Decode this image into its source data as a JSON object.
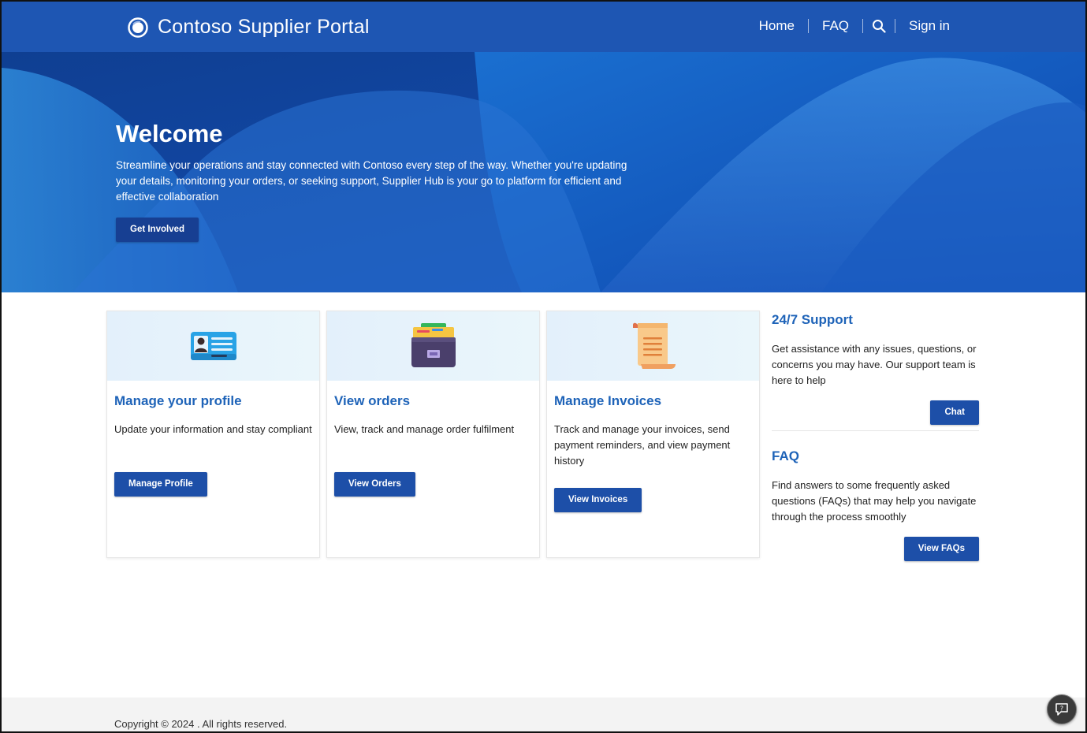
{
  "header": {
    "title": "Contoso Supplier Portal",
    "nav": {
      "home": "Home",
      "faq": "FAQ",
      "signin": "Sign in"
    },
    "logo_icon": "contoso-logo-icon",
    "search_icon": "search-icon",
    "color": "#1e56b3"
  },
  "hero": {
    "title": "Welcome",
    "text": "Streamline your operations and stay connected with Contoso every step of the way. Whether you're updating your details, monitoring your orders, or seeking support, Supplier Hub is your go to platform for efficient and effective collaboration",
    "button": "Get Involved"
  },
  "cards": [
    {
      "icon": "id-card-icon",
      "title": "Manage your profile",
      "text": "Update your information and stay compliant",
      "button": "Manage Profile"
    },
    {
      "icon": "file-box-icon",
      "title": "View orders",
      "text": "View, track and manage order fulfilment",
      "button": "View Orders"
    },
    {
      "icon": "scroll-icon",
      "title": "Manage Invoices",
      "text": "Track and manage your invoices, send payment reminders, and view payment history",
      "button": "View Invoices"
    }
  ],
  "support": {
    "title": "24/7 Support",
    "text": "Get assistance with any issues, questions, or concerns you may have. Our support team is here to help",
    "button": "Chat"
  },
  "faq": {
    "title": "FAQ",
    "text": "Find answers to some frequently asked questions (FAQs) that may help you navigate through the process smoothly",
    "button": "View FAQs"
  },
  "footer": {
    "copyright": "Copyright © 2024 . All rights reserved."
  },
  "chat_widget": {
    "icon": "chat-help-icon"
  },
  "colors": {
    "primary": "#1d4fa8",
    "link": "#1e63b8"
  }
}
